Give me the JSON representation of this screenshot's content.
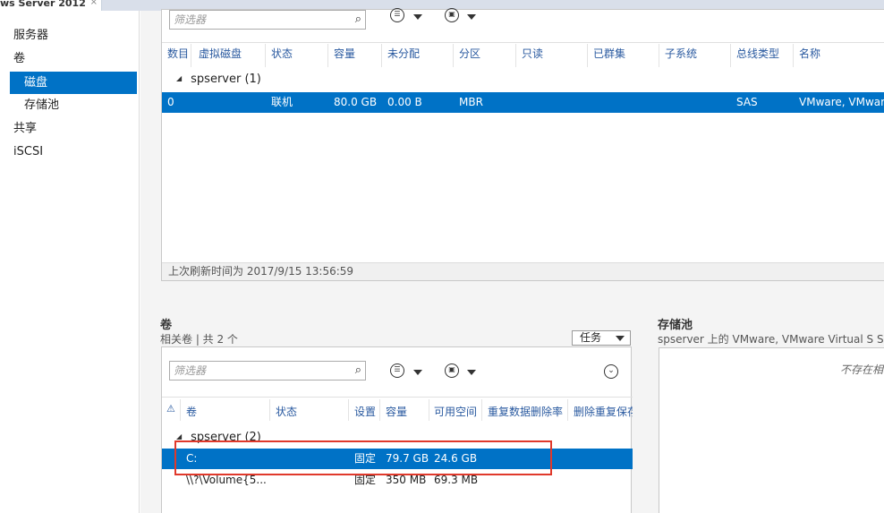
{
  "window": {
    "title": "ws Server 2012",
    "close_glyph": "×"
  },
  "sidebar": {
    "items": [
      {
        "label": "服务器"
      },
      {
        "label": "卷"
      },
      {
        "label": "磁盘"
      },
      {
        "label": "存储池"
      },
      {
        "label": "共享"
      },
      {
        "label": "iSCSI"
      }
    ]
  },
  "icons": {
    "search": "search-icon",
    "list_options": "list-options-icon",
    "save_query": "save-query-icon",
    "expand": "expand-collapse-icon"
  },
  "disks": {
    "filter_placeholder": "筛选器",
    "columns": [
      "数目",
      "虚拟磁盘",
      "状态",
      "容量",
      "未分配",
      "分区",
      "只读",
      "已群集",
      "子系统",
      "总线类型",
      "名称"
    ],
    "group": "spserver (1)",
    "rows": [
      {
        "number": "0",
        "virtual_disk": "",
        "status": "联机",
        "capacity": "80.0 GB",
        "unallocated": "0.00 B",
        "partition": "MBR",
        "readonly": "",
        "clustered": "",
        "subsystem": "",
        "bus_type": "SAS",
        "name": "VMware, VMware"
      }
    ],
    "last_refresh": "上次刷新时间为 2017/9/15 13:56:59"
  },
  "volumes": {
    "title": "卷",
    "subtitle": "相关卷 | 共 2 个",
    "tasks_label": "任务",
    "filter_placeholder": "筛选器",
    "columns": [
      "卷",
      "状态",
      "设置",
      "容量",
      "可用空间",
      "重复数据删除率",
      "删除重复保存"
    ],
    "group": "spserver (2)",
    "rows": [
      {
        "volume": "C:",
        "status": "",
        "provisioning": "固定",
        "capacity": "79.7 GB",
        "free": "24.6 GB"
      },
      {
        "volume": "\\\\?\\Volume{5...",
        "status": "",
        "provisioning": "固定",
        "capacity": "350 MB",
        "free": "69.3 MB"
      }
    ]
  },
  "storage_pool": {
    "title": "存储池",
    "subtitle": "spserver 上的 VMware, VMware Virtual S SCSI",
    "empty_text": "不存在相"
  },
  "colors": {
    "selection": "#0072c6",
    "highlight_box": "#e0392b",
    "header_text": "#2a5aa0"
  }
}
